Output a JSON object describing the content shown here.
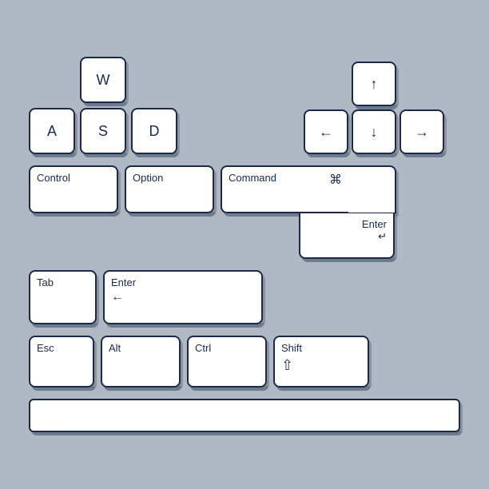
{
  "keys": {
    "w": "W",
    "a": "A",
    "s": "S",
    "d": "D",
    "up": "↑",
    "left": "←",
    "down": "↓",
    "right": "→",
    "control": "Control",
    "option": "Option",
    "command": "Command",
    "command_icon": "⌘",
    "tab": "Tab",
    "enter_horiz": "Enter",
    "enter_horiz_arrow": "←",
    "enter_vert": "Enter",
    "enter_vert_arrow": "↵",
    "esc": "Esc",
    "alt": "Alt",
    "ctrl": "Ctrl",
    "shift": "Shift",
    "shift_icon": "⇧",
    "space": ""
  },
  "colors": {
    "bg": "#b0b8c4",
    "key_bg": "#ffffff",
    "key_border": "#1a2a4a",
    "key_shadow": "#8a9ab0",
    "key_text": "#1a2a4a"
  }
}
